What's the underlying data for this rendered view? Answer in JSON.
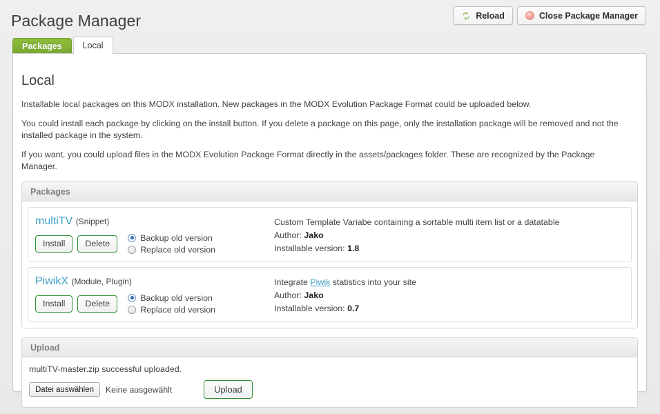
{
  "header": {
    "title": "Package Manager",
    "buttons": [
      {
        "label": "Reload",
        "icon": "reload-icon"
      },
      {
        "label": "Close Package Manager",
        "icon": "close-circle-icon"
      }
    ]
  },
  "tabs": [
    {
      "label": "Packages",
      "active": false
    },
    {
      "label": "Local",
      "active": true
    }
  ],
  "main": {
    "section_title": "Local",
    "intro": [
      "Installable local packages on this MODX installation. New packages in the MODX Evolution Package Format could be uploaded below.",
      "You could install each package by clicking on the install button. If you delete a package on this page, only the installation package will be removed and not the installed package in the system.",
      "If you want, you could upload files in the MODX Evolution Package Format directly in the assets/packages folder. These are recognized by the Package Manager."
    ]
  },
  "packages_panel": {
    "heading": "Packages",
    "buttons": {
      "install": "Install",
      "delete": "Delete"
    },
    "radio_backup": "Backup old version",
    "radio_replace": "Replace old version",
    "author_label": "Author:",
    "version_label": "Installable version:",
    "items": [
      {
        "name": "multiTV",
        "kind": "(Snippet)",
        "description_before": "Custom Template Variabe containing a sortable multi item list or a datatable",
        "link_text": "",
        "description_after": "",
        "author": "Jako",
        "version": "1.8",
        "backup_selected": true
      },
      {
        "name": "PiwikX",
        "kind": "(Module, Plugin)",
        "description_before": "Integrate ",
        "link_text": "Piwik",
        "description_after": " statistics into your site",
        "author": "Jako",
        "version": "0.7",
        "backup_selected": true
      }
    ]
  },
  "upload_panel": {
    "heading": "Upload",
    "status_message": "multiTV-master.zip successful uploaded.",
    "file_button_label": "Datei auswählen",
    "file_name": "Keine ausgewählt",
    "upload_button_label": "Upload"
  },
  "colors": {
    "accent_green": "#7aa832",
    "link_blue": "#3f9fc4",
    "button_border_green": "#2f8f2f",
    "page_background": "#ececec"
  }
}
